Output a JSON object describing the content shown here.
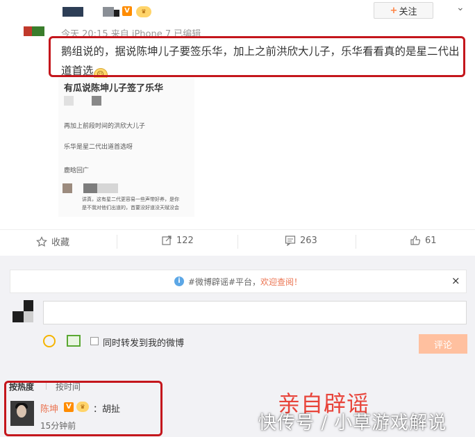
{
  "header": {
    "follow_label": "关注",
    "follow_plus": "+",
    "chevron": "⌄",
    "verified_badge": "V",
    "level_badge": "",
    "meta": "今天 20:15 来自 iPhone 7  已编辑"
  },
  "post": {
    "text": "鹅组说的，据说陈坤儿子要签乐华，加上之前洪欣大儿子，乐华看看真的是星二代出道首选",
    "emoji": "☺"
  },
  "embedded_image": {
    "heading": "有瓜说陈坤儿子签了乐华",
    "line1": "再加上前段时间的洪欣大儿子",
    "line2": "乐华是星二代出道首选呀",
    "line3": "鹿晗回广",
    "line4": "讲真，这有星二代更容易一些声带好养，是你",
    "line5": "是不我对他们出道的，首要没好道没天赋没会"
  },
  "actions": {
    "favorite": {
      "icon": "star-icon",
      "label": "收藏"
    },
    "repost": {
      "icon": "repost-icon",
      "label": "122"
    },
    "comment": {
      "icon": "comment-icon",
      "label": "263"
    },
    "like": {
      "icon": "thumbs-up-icon",
      "label": "61"
    }
  },
  "notice": {
    "icon": "info-icon",
    "prefix": "#微博辟谣#平台，",
    "link": "欢迎查阅！",
    "close": "×"
  },
  "composer": {
    "input_value": "",
    "repost_checkbox_label": "同时转发到我的微博",
    "submit_label": "评论"
  },
  "sort": {
    "hot": "按热度",
    "time": "按时间"
  },
  "reply": {
    "name": "陈坤",
    "verified": "V",
    "level": "",
    "text": "：胡扯",
    "time": "15分钟前"
  },
  "overlay": {
    "title": "亲自辟谣",
    "watermark": "快传号 / 小草游戏解说"
  },
  "colors": {
    "accent_orange": "#eb7350",
    "highlight_red": "#c4161c",
    "overlay_red": "#e8443a",
    "submit_bg": "#ffc09f"
  }
}
